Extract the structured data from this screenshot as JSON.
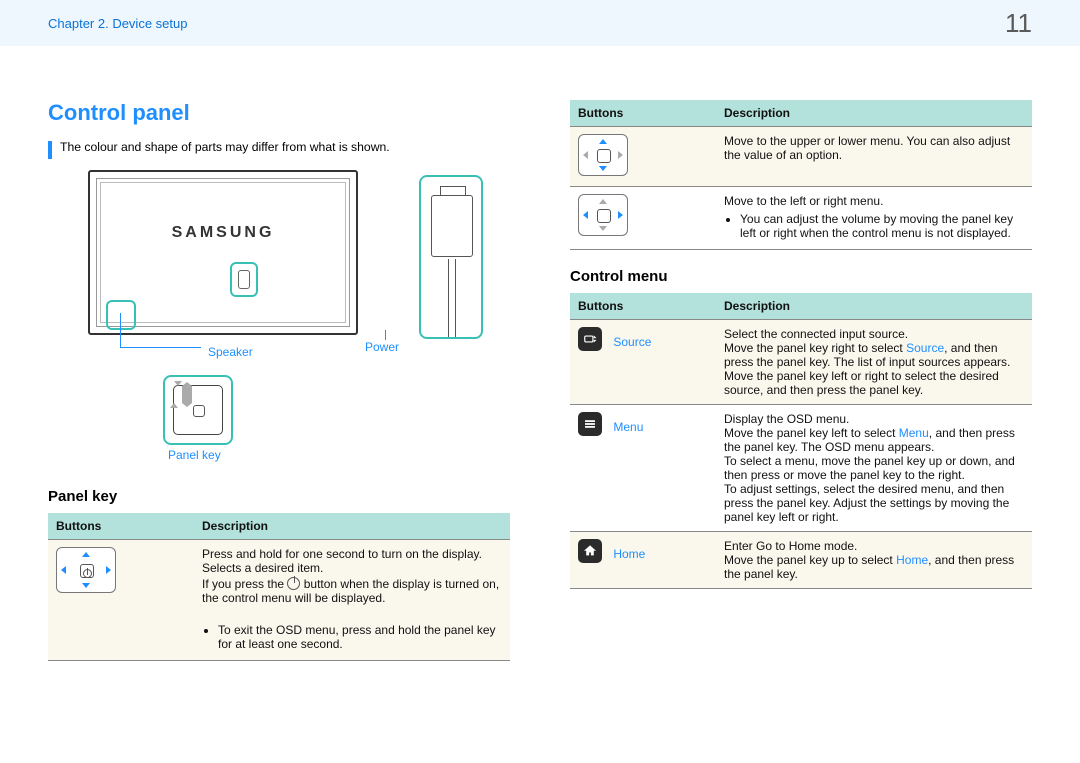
{
  "header": {
    "chapter": "Chapter 2. Device setup",
    "page_number": "11"
  },
  "left": {
    "title": "Control panel",
    "lead": "The colour and shape of parts may differ from what is shown.",
    "fig_labels": {
      "speaker": "Speaker",
      "power": "Power",
      "panel_key": "Panel key"
    },
    "logo": "SAMSUNG",
    "section_panel_key": "Panel key",
    "table1": {
      "head_buttons": "Buttons",
      "head_desc": "Description",
      "row1": {
        "d1": "Press and hold for one second to turn on the display.",
        "d2": "Selects a desired item.",
        "d3a": "If you press the ",
        "d3b": " button when the display is turned on, the control menu will be displayed.",
        "bullet": "To exit the OSD menu, press and hold the panel key for at least one second."
      }
    }
  },
  "right": {
    "table2": {
      "head_buttons": "Buttons",
      "head_desc": "Description",
      "row_ud": "Move to the upper or lower menu. You can also adjust the value of an option.",
      "row_lr": {
        "d1": "Move to the left or right menu.",
        "bullet": "You can adjust the volume by moving the panel key left or right when the control menu is not displayed."
      }
    },
    "section_control_menu": "Control menu",
    "table3": {
      "head_buttons": "Buttons",
      "head_desc": "Description",
      "source": {
        "name": "Source",
        "d1": "Select the connected input source.",
        "d2a": "Move the panel key right to select ",
        "d2b": ", and then press the panel key. The list of input sources appears. Move the panel key left or right to select the desired source, and then press the panel key."
      },
      "menu": {
        "name": "Menu",
        "d1": "Display the OSD menu.",
        "d2a": "Move the panel key left to select ",
        "d2b": ", and then press the panel key. The OSD menu appears.",
        "d3": "To select a menu, move the panel key up or down, and then press or move the panel key to the right.",
        "d4": "To adjust settings, select the desired menu, and then press the panel key. Adjust the settings by moving the panel key left or right."
      },
      "home": {
        "name": "Home",
        "d1": "Enter Go to Home mode.",
        "d2a": "Move the panel key up to select ",
        "d2b": ", and then press the panel key."
      }
    }
  }
}
